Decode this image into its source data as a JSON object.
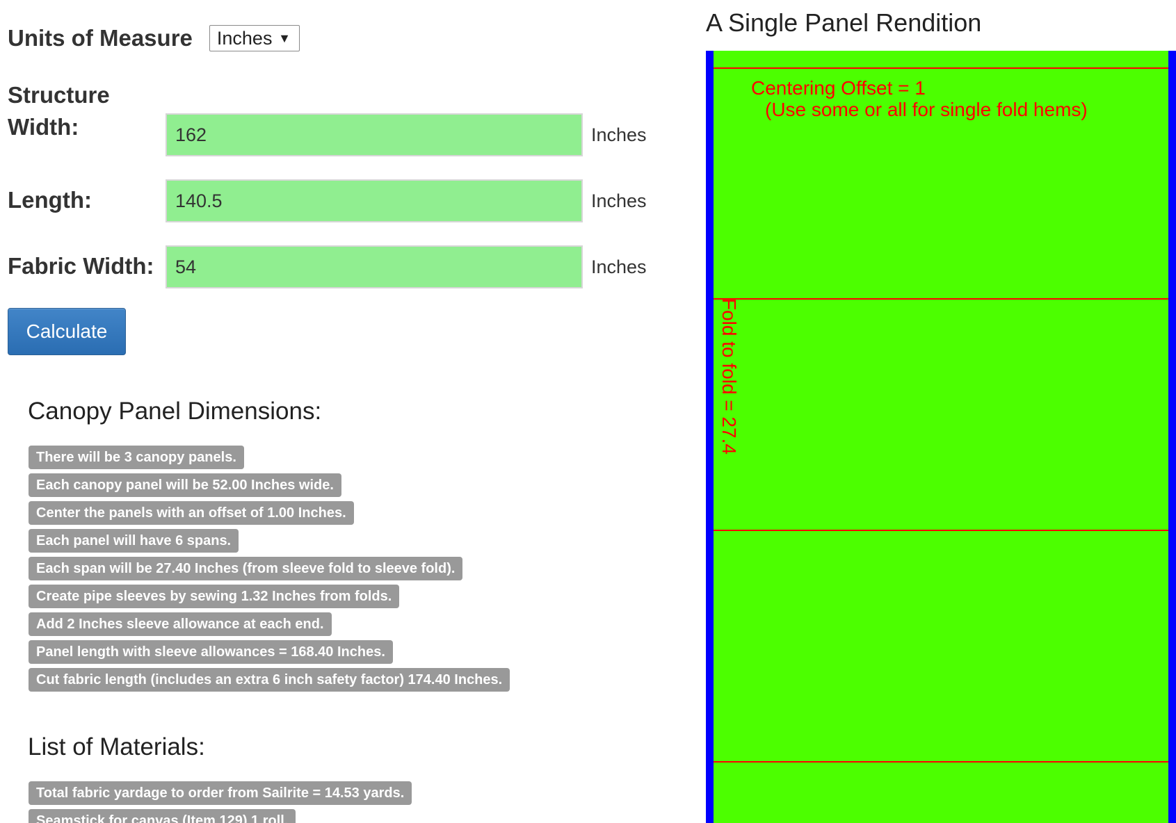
{
  "units": {
    "label": "Units of Measure",
    "selected": "Inches"
  },
  "fields": {
    "structure_width": {
      "label": "Structure Width:",
      "value": "162",
      "unit": "Inches"
    },
    "length": {
      "label": "Length:",
      "value": "140.5",
      "unit": "Inches"
    },
    "fabric_width": {
      "label": "Fabric Width:",
      "value": "54",
      "unit": "Inches"
    }
  },
  "calculate_label": "Calculate",
  "dimensions": {
    "title": "Canopy Panel Dimensions:",
    "items": [
      "There will be 3 canopy panels.",
      "Each canopy panel will be 52.00 Inches wide.",
      "Center the panels with an offset of 1.00 Inches.",
      "Each panel will have 6 spans.",
      "Each span will be 27.40 Inches (from sleeve fold to sleeve fold).",
      "Create pipe sleeves by sewing 1.32 Inches from folds.",
      "Add 2 Inches sleeve allowance at each end.",
      "Panel length with sleeve allowances = 168.40 Inches.",
      "Cut fabric length (includes an extra 6 inch safety factor) 174.40 Inches."
    ]
  },
  "materials": {
    "title": "List of Materials:",
    "items": [
      "Total fabric yardage to order from Sailrite = 14.53 yards.",
      "Seamstick for canvas (Item 129) 1 roll."
    ]
  },
  "rendition": {
    "title": "A Single Panel Rendition",
    "offset_line1": "Centering Offset = 1",
    "offset_line2": "(Use some or all for single fold hems)",
    "fold_label": "Fold to fold = 27.4",
    "colors": {
      "fabric": "#4cff00",
      "edge": "#0000ff",
      "fold_line": "#ff0000"
    }
  }
}
